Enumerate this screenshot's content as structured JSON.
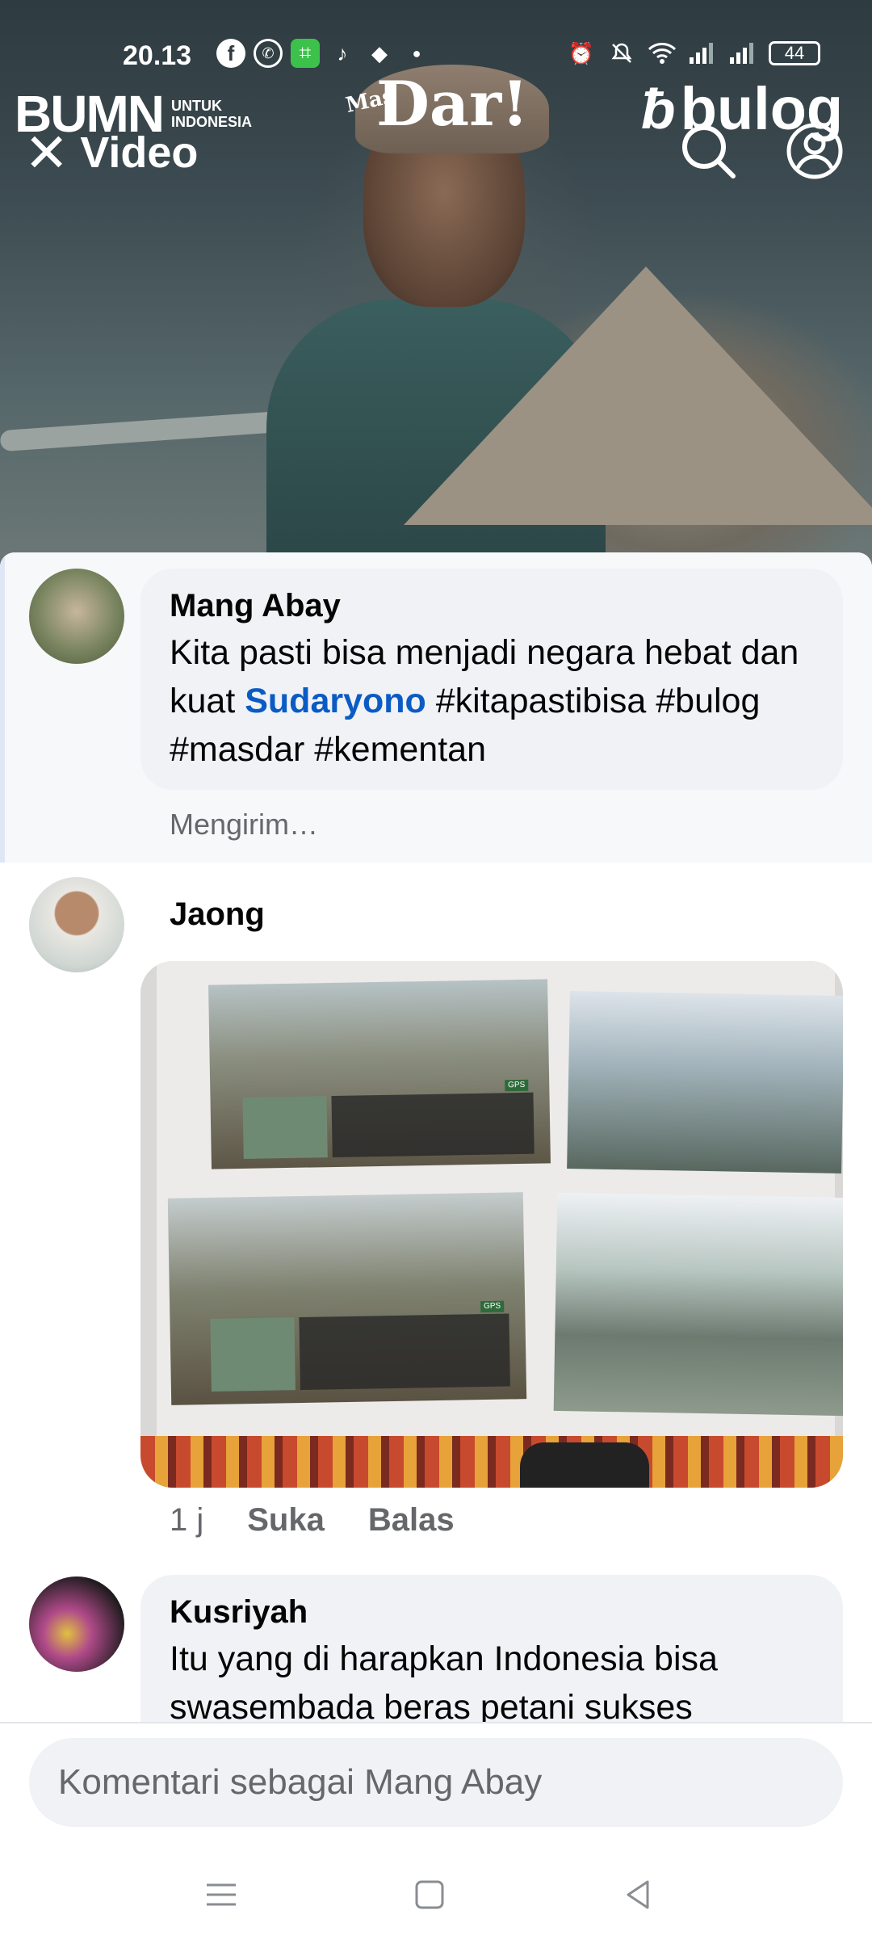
{
  "status_bar": {
    "time": "20.13",
    "battery": "44",
    "left_icons": [
      "facebook-icon",
      "whatsapp-icon",
      "app-icon",
      "tiktok-icon",
      "cube-icon",
      "dot-icon"
    ],
    "right_icons": [
      "alarm-icon",
      "mute-icon",
      "wifi-icon",
      "signal-icon",
      "signal-icon",
      "battery-icon"
    ]
  },
  "video": {
    "brand_left_big": "BUMN",
    "brand_left_small": "UNTUK INDONESIA",
    "brand_center_small": "Mas",
    "brand_center_big": "Dar!",
    "brand_right": "bulog",
    "header": {
      "close_label": "Video"
    }
  },
  "comments": [
    {
      "author": "Mang Abay",
      "text_before": "Kita pasti bisa menjadi negara hebat dan kuat ",
      "mention": "Sudaryono",
      "text_after": " #kitapastibisa #bulog #masdar #kementan",
      "status": "Mengirim…"
    },
    {
      "author": "Jaong",
      "time": "1 j",
      "like_label": "Suka",
      "reply_label": "Balas"
    },
    {
      "author": "Kusriyah",
      "text": "Itu yang di harapkan Indonesia bisa swasembada beras petani sukses"
    }
  ],
  "composer": {
    "placeholder": "Komentari sebagai Mang Abay"
  },
  "colors": {
    "mention": "#0a5bc4",
    "bubble": "#f0f2f5",
    "secondary_text": "#65676b"
  }
}
